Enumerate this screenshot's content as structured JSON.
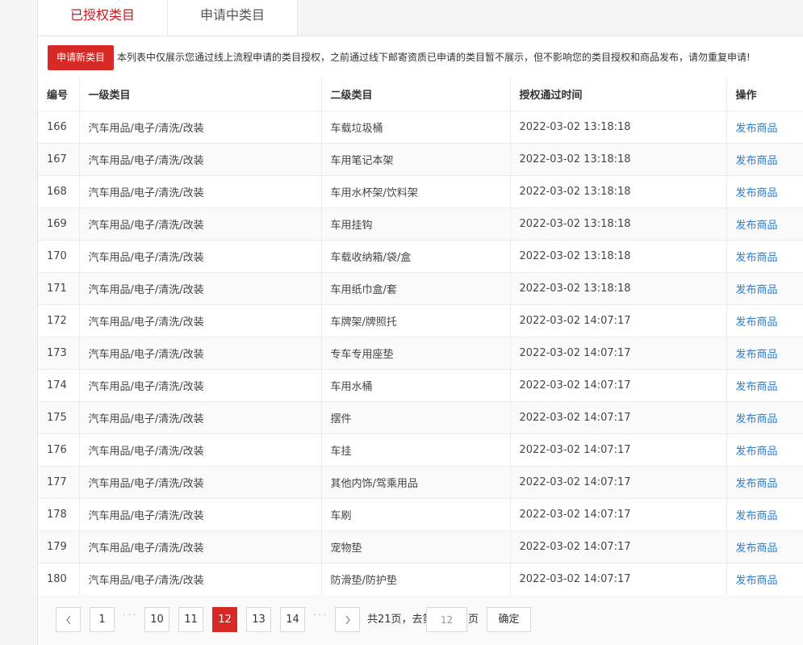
{
  "tabs": [
    {
      "label": "已授权类目"
    },
    {
      "label": "申请中类目"
    }
  ],
  "notice": {
    "apply_button": "申请新类目",
    "text": "本列表中仅展示您通过线上流程申请的类目授权，之前通过线下邮寄资质已申请的类目暂不展示，但不影响您的类目授权和商品发布，请勿重复申请!"
  },
  "table": {
    "headers": [
      "编号",
      "一级类目",
      "二级类目",
      "授权通过时间",
      "操作"
    ],
    "rows": [
      [
        "166",
        "汽车用品/电子/清洗/改装",
        "车载垃圾桶",
        "2022-03-02 13:18:18",
        "发布商品"
      ],
      [
        "167",
        "汽车用品/电子/清洗/改装",
        "车用笔记本架",
        "2022-03-02 13:18:18",
        "发布商品"
      ],
      [
        "168",
        "汽车用品/电子/清洗/改装",
        "车用水杯架/饮料架",
        "2022-03-02 13:18:18",
        "发布商品"
      ],
      [
        "169",
        "汽车用品/电子/清洗/改装",
        "车用挂钩",
        "2022-03-02 13:18:18",
        "发布商品"
      ],
      [
        "170",
        "汽车用品/电子/清洗/改装",
        "车载收纳箱/袋/盒",
        "2022-03-02 13:18:18",
        "发布商品"
      ],
      [
        "171",
        "汽车用品/电子/清洗/改装",
        "车用纸巾盒/套",
        "2022-03-02 13:18:18",
        "发布商品"
      ],
      [
        "172",
        "汽车用品/电子/清洗/改装",
        "车牌架/牌照托",
        "2022-03-02 14:07:17",
        "发布商品"
      ],
      [
        "173",
        "汽车用品/电子/清洗/改装",
        "专车专用座垫",
        "2022-03-02 14:07:17",
        "发布商品"
      ],
      [
        "174",
        "汽车用品/电子/清洗/改装",
        "车用水桶",
        "2022-03-02 14:07:17",
        "发布商品"
      ],
      [
        "175",
        "汽车用品/电子/清洗/改装",
        "摆件",
        "2022-03-02 14:07:17",
        "发布商品"
      ],
      [
        "176",
        "汽车用品/电子/清洗/改装",
        "车挂",
        "2022-03-02 14:07:17",
        "发布商品"
      ],
      [
        "177",
        "汽车用品/电子/清洗/改装",
        "其他内饰/驾乘用品",
        "2022-03-02 14:07:17",
        "发布商品"
      ],
      [
        "178",
        "汽车用品/电子/清洗/改装",
        "车刷",
        "2022-03-02 14:07:17",
        "发布商品"
      ],
      [
        "179",
        "汽车用品/电子/清洗/改装",
        "宠物垫",
        "2022-03-02 14:07:17",
        "发布商品"
      ],
      [
        "180",
        "汽车用品/电子/清洗/改装",
        "防滑垫/防护垫",
        "2022-03-02 14:07:17",
        "发布商品"
      ]
    ]
  },
  "pagination": {
    "prev_icon": "chevron-left-icon",
    "next_icon": "chevron-right-icon",
    "pages": [
      "1",
      "10",
      "11",
      "12",
      "13",
      "14"
    ],
    "current": "12",
    "ellipsis": "···",
    "total_text": "共21页，去第",
    "goto_value": "12",
    "page_suffix": "页",
    "confirm_label": "确定"
  },
  "colors": {
    "accent": "#d72a26",
    "active_tab": "#c8161d",
    "link": "#2a7ccf"
  }
}
